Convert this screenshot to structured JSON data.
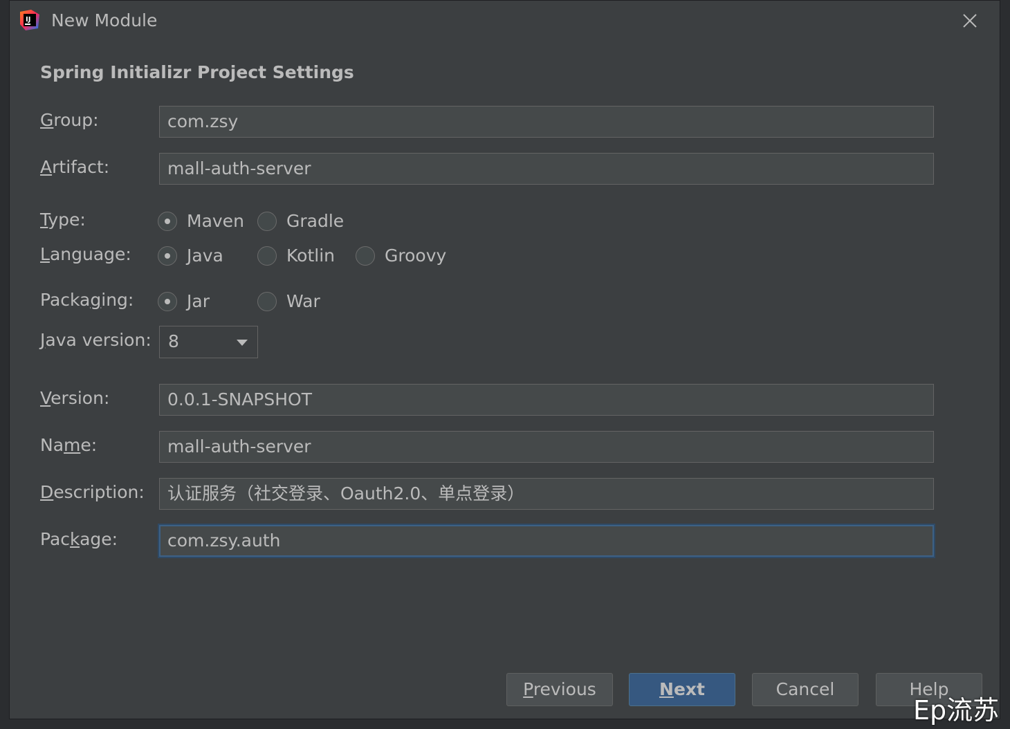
{
  "window": {
    "title": "New Module"
  },
  "section_title": "Spring Initializr Project Settings",
  "fields": {
    "group": {
      "label_mn": "G",
      "label_rest": "roup:",
      "value": "com.zsy"
    },
    "artifact": {
      "label_mn": "A",
      "label_rest": "rtifact:",
      "value": "mall-auth-server"
    },
    "version": {
      "label_mn": "V",
      "label_rest": "ersion:",
      "value": "0.0.1-SNAPSHOT"
    },
    "name": {
      "label_pre": "Na",
      "label_mn": "m",
      "label_rest": "e:",
      "value": "mall-auth-server"
    },
    "description": {
      "label_mn": "D",
      "label_rest": "escription:",
      "value": "认证服务（社交登录、Oauth2.0、单点登录）"
    },
    "package": {
      "label_pre": "Pac",
      "label_mn": "k",
      "label_rest": "age:",
      "value": "com.zsy.auth"
    }
  },
  "type": {
    "label_mn": "T",
    "label_rest": "ype:",
    "options": [
      {
        "label": "Maven",
        "checked": true
      },
      {
        "label": "Gradle",
        "checked": false
      }
    ]
  },
  "language": {
    "label_mn": "L",
    "label_rest": "anguage:",
    "options": [
      {
        "label": "Java",
        "checked": true
      },
      {
        "label": "Kotlin",
        "checked": false
      },
      {
        "label": "Groovy",
        "checked": false
      }
    ]
  },
  "packaging": {
    "label_pre": "Packa",
    "label_mn": "g",
    "label_rest": "ing:",
    "options": [
      {
        "label": "Jar",
        "checked": true
      },
      {
        "label": "War",
        "checked": false
      }
    ]
  },
  "java_version": {
    "label_mn": "J",
    "label_rest": "ava version:",
    "value": "8"
  },
  "buttons": {
    "previous": {
      "mn": "P",
      "rest": "revious"
    },
    "next": {
      "mn": "N",
      "rest": "ext"
    },
    "cancel": "Cancel",
    "help": "Help"
  },
  "watermark": "Ep流苏",
  "colors": {
    "background": "#3c3f41",
    "field": "#45494a",
    "primary_button": "#365880",
    "focus_border": "#3d6185"
  }
}
